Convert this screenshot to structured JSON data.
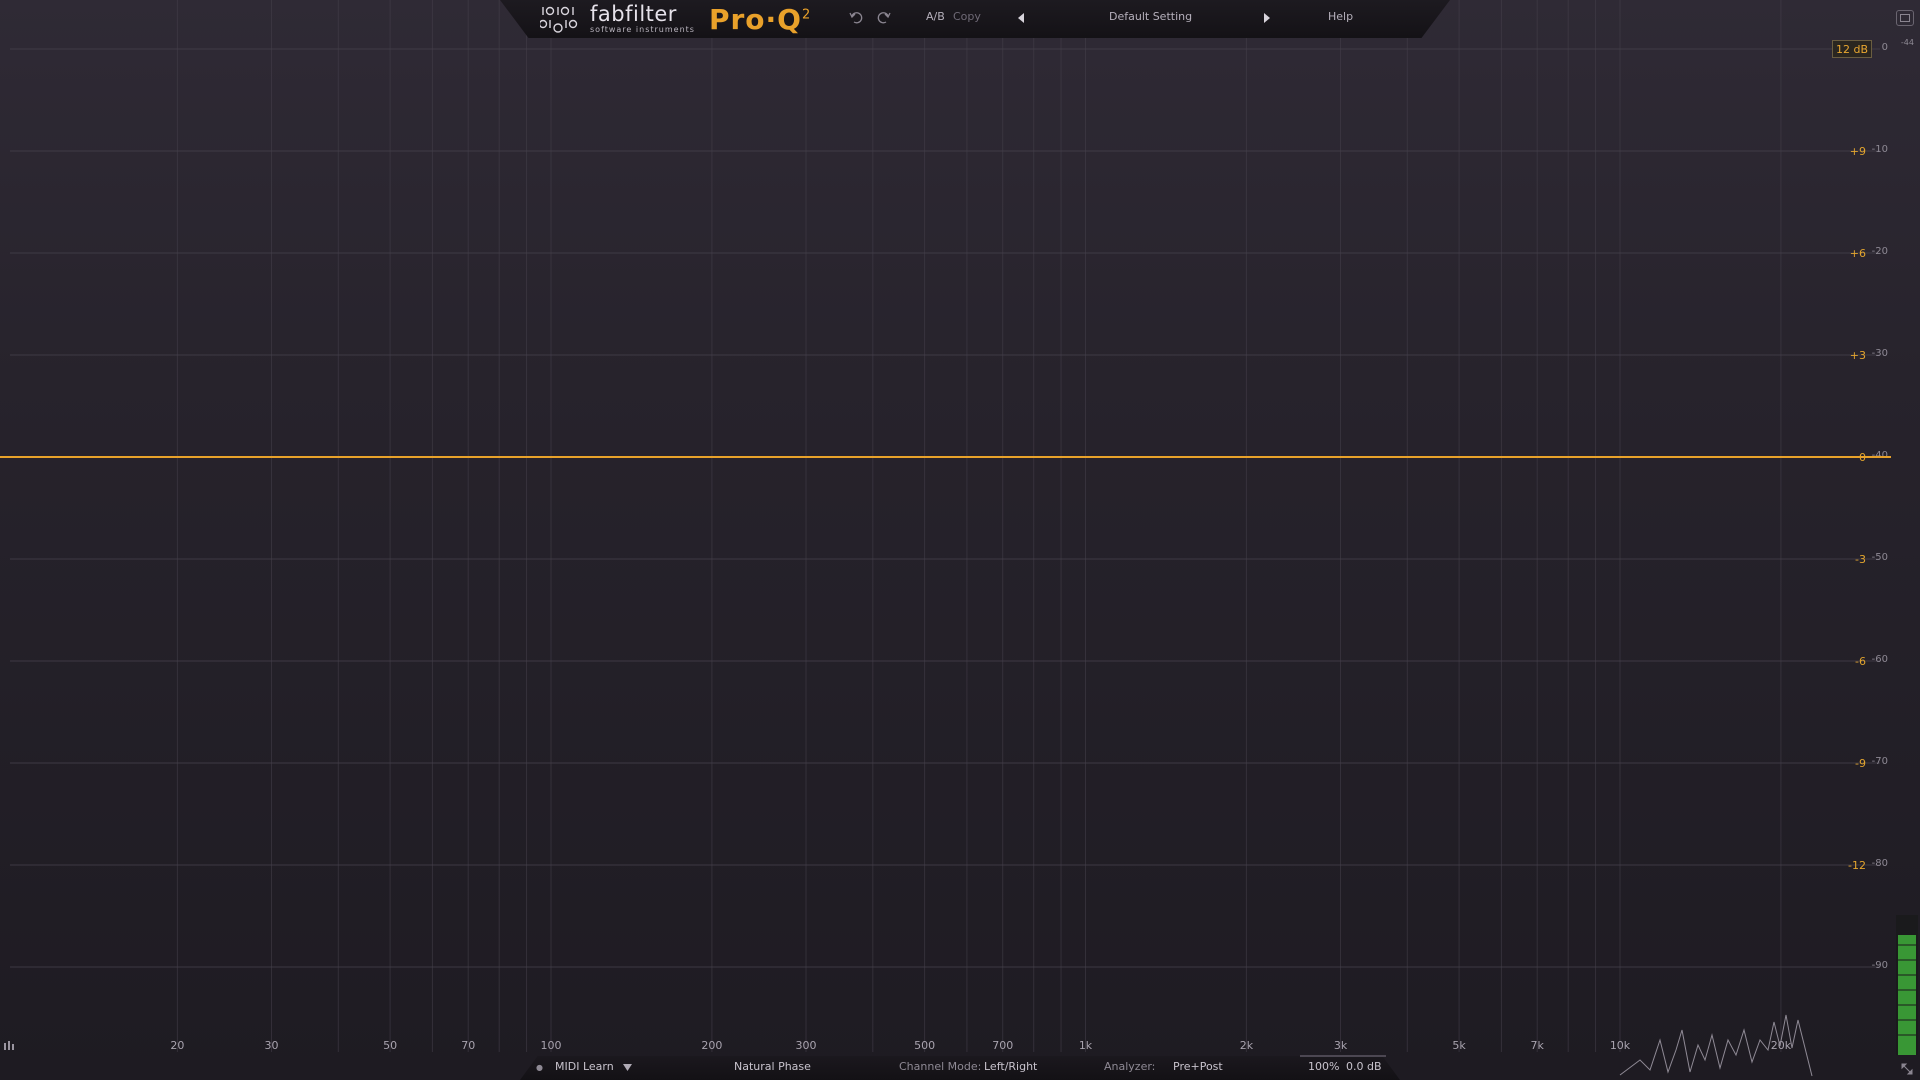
{
  "header": {
    "brand": "fabfilter",
    "tagline": "software instruments",
    "product": "Pro·Q",
    "product_version": "2",
    "ab_label": "A/B",
    "copy_label": "Copy",
    "preset_name": "Default Setting",
    "help_label": "Help",
    "icons": [
      "undo-icon",
      "redo-icon",
      "preset-prev-icon",
      "preset-next-icon",
      "fullscreen-icon"
    ]
  },
  "graph": {
    "range_label": "12 dB",
    "meter_ref_label": "-44",
    "freq_labels": [
      "20",
      "30",
      "50",
      "70",
      "100",
      "200",
      "300",
      "500",
      "700",
      "1k",
      "2k",
      "3k",
      "5k",
      "7k",
      "10k",
      "20k"
    ],
    "gain_labels": [
      "+9",
      "+6",
      "+3",
      "0",
      "-3",
      "-6",
      "-9",
      "-12"
    ],
    "meter_labels": [
      "0",
      "-10",
      "-20",
      "-30",
      "-40",
      "-50",
      "-60",
      "-70",
      "-80",
      "-90"
    ],
    "colors": {
      "curve": "#e8a22a",
      "gain_text": "#e3a52e",
      "grid": "#45404b",
      "meter": "#3fae3a"
    }
  },
  "footer": {
    "midi_learn_label": "MIDI Learn",
    "phase_mode": "Natural Phase",
    "channel_mode_label": "Channel Mode:",
    "channel_mode_value": "Left/Right",
    "analyzer_label": "Analyzer:",
    "analyzer_value": "Pre+Post",
    "zoom": "100%",
    "output_gain": "0.0 dB"
  }
}
